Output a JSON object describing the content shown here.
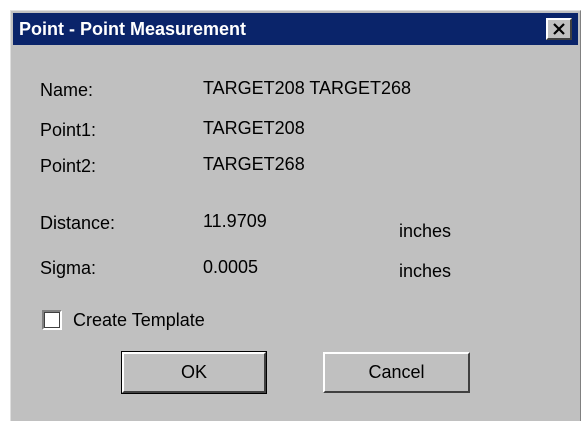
{
  "window": {
    "title": "Point - Point Measurement"
  },
  "fields": {
    "name_label": "Name:",
    "name_value": "TARGET208 TARGET268",
    "point1_label": "Point1:",
    "point1_value": "TARGET208",
    "point2_label": "Point2:",
    "point2_value": "TARGET268",
    "distance_label": "Distance:",
    "distance_value": "11.9709",
    "distance_unit": "inches",
    "sigma_label": "Sigma:",
    "sigma_value": "0.0005",
    "sigma_unit": "inches"
  },
  "options": {
    "create_template_label": "Create Template",
    "create_template_checked": false
  },
  "buttons": {
    "ok_label": "OK",
    "cancel_label": "Cancel"
  },
  "colors": {
    "title_bar": "#0a246a",
    "dialog_face": "#c0c0c0"
  },
  "icons": {
    "close": "close-icon"
  }
}
